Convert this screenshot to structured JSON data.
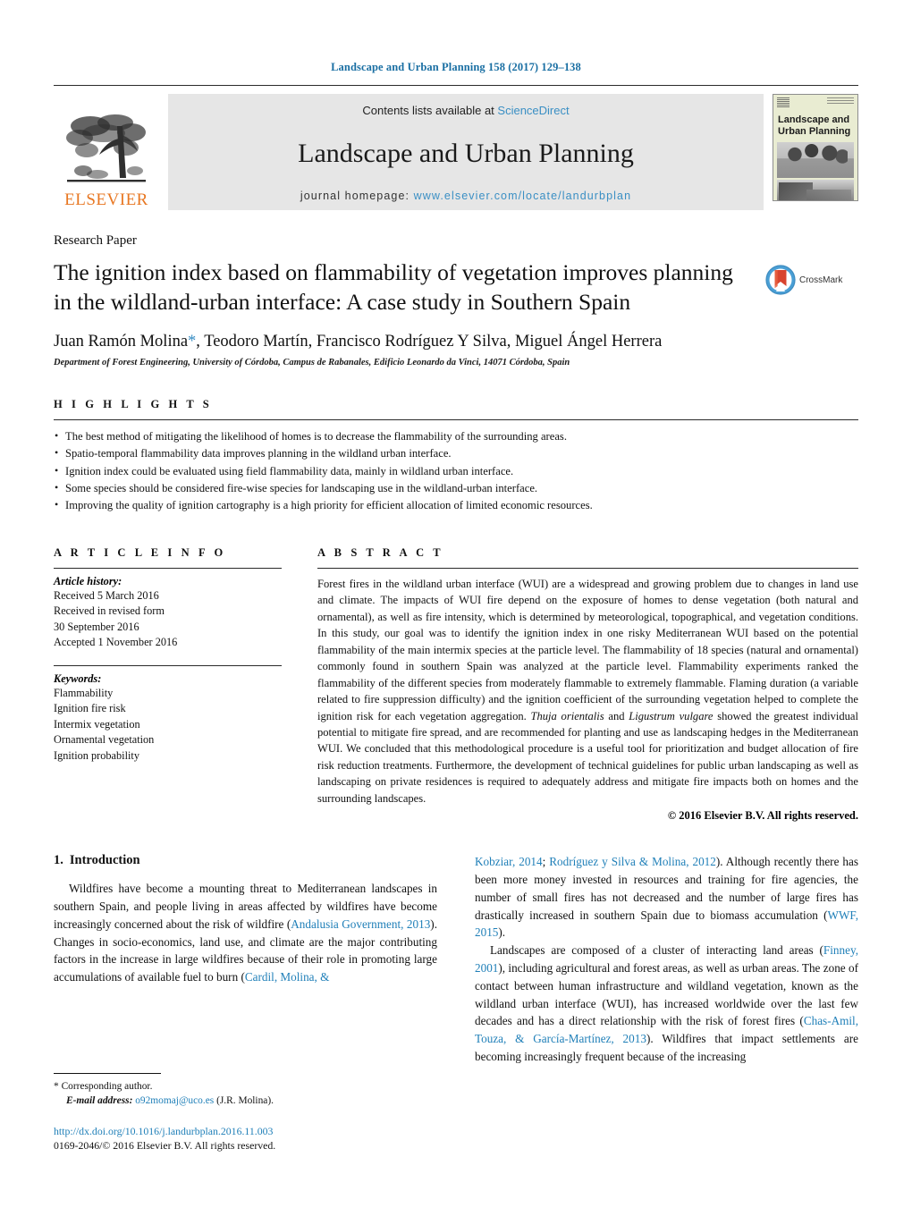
{
  "running_head": "Landscape and Urban Planning 158 (2017) 129–138",
  "masthead": {
    "publisher_name": "ELSEVIER",
    "contents_prefix": "Contents lists available at ",
    "contents_link": "ScienceDirect",
    "journal_title": "Landscape and Urban Planning",
    "homepage_prefix": "journal homepage: ",
    "homepage_url": "www.elsevier.com/locate/landurbplan",
    "cover_title_line1": "Landscape and",
    "cover_title_line2": "Urban Planning",
    "link_color": "#3a8fc4"
  },
  "article": {
    "type": "Research Paper",
    "title": "The ignition index based on flammability of vegetation improves planning in the wildland-urban interface: A case study in Southern Spain",
    "crossmark_label": "CrossMark",
    "authors": "Juan Ramón Molina",
    "authors_rest": ", Teodoro Martín, Francisco Rodríguez Y Silva, Miguel Ángel Herrera",
    "corresponding_marker": "*",
    "affiliation": "Department of Forest Engineering, University of Córdoba, Campus de Rabanales, Edificio Leonardo da Vinci, 14071 Córdoba, Spain"
  },
  "highlights": {
    "heading": "H I G H L I G H T S",
    "items": [
      "The best method of mitigating the likelihood of homes is to decrease the flammability of the surrounding areas.",
      "Spatio-temporal flammability data improves planning in the wildland urban interface.",
      "Ignition index could be evaluated using field flammability data, mainly in wildland urban interface.",
      "Some species should be considered fire-wise species for landscaping use in the wildland-urban interface.",
      "Improving the quality of ignition cartography is a high priority for efficient allocation of limited economic resources."
    ]
  },
  "article_info": {
    "heading": "A R T I C L E   I N F O",
    "history_label": "Article history:",
    "history": [
      "Received 5 March 2016",
      "Received in revised form",
      "30 September 2016",
      "Accepted 1 November 2016"
    ],
    "keywords_label": "Keywords:",
    "keywords": [
      "Flammability",
      "Ignition fire risk",
      "Intermix vegetation",
      "Ornamental vegetation",
      "Ignition probability"
    ]
  },
  "abstract": {
    "heading": "A B S T R A C T",
    "part1": "Forest fires in the wildland urban interface (WUI) are a widespread and growing problem due to changes in land use and climate. The impacts of WUI fire depend on the exposure of homes to dense vegetation (both natural and ornamental), as well as fire intensity, which is determined by meteorological, topographical, and vegetation conditions. In this study, our goal was to identify the ignition index in one risky Mediterranean WUI based on the potential flammability of the main intermix species at the particle level. The flammability of 18 species (natural and ornamental) commonly found in southern Spain was analyzed at the particle level. Flammability experiments ranked the flammability of the different species from moderately flammable to extremely flammable. Flaming duration (a variable related to fire suppression difficulty) and the ignition coefficient of the surrounding vegetation helped to complete the ignition risk for each vegetation aggregation. ",
    "italic1": "Thuja orientalis",
    "mid1": " and ",
    "italic2": "Ligustrum vulgare",
    "part2": " showed the greatest individual potential to mitigate fire spread, and are recommended for planting and use as landscaping hedges in the Mediterranean WUI. We concluded that this methodological procedure is a useful tool for prioritization and budget allocation of fire risk reduction treatments. Furthermore, the development of technical guidelines for public urban landscaping as well as landscaping on private residences is required to adequately address and mitigate fire impacts both on homes and the surrounding landscapes.",
    "copyright": "© 2016 Elsevier B.V. All rights reserved."
  },
  "introduction": {
    "number": "1.",
    "title": "Introduction",
    "left_p1_a": "Wildfires have become a mounting threat to Mediterranean landscapes in southern Spain, and people living in areas affected by wildfires have become increasingly concerned about the risk of wildfire (",
    "left_ref1": "Andalusia Government, 2013",
    "left_p1_b": "). Changes in socio-economics, land use, and climate are the major contributing factors in the increase in large wildfires because of their role in promoting large accumulations of available fuel to burn (",
    "left_ref2": "Cardil, Molina, &",
    "right_ref2_cont": "Kobziar, 2014",
    "right_semicolon": "; ",
    "right_ref3": "Rodríguez y Silva & Molina, 2012",
    "right_p1_b": "). Although recently there has been more money invested in resources and training for fire agencies, the number of small fires has not decreased and the number of large fires has drastically increased in southern Spain due to biomass accumulation (",
    "right_ref4": "WWF, 2015",
    "right_p1_c": ").",
    "right_p2_a": "Landscapes are composed of a cluster of interacting land areas (",
    "right_ref5": "Finney, 2001",
    "right_p2_b": "), including agricultural and forest areas, as well as urban areas. The zone of contact between human infrastructure and wildland vegetation, known as the wildland urban interface (WUI), has increased worldwide over the last few decades and has a direct relationship with the risk of forest fires (",
    "right_ref6": "Chas-Amil, Touza, & García-Martínez, 2013",
    "right_p2_c": "). Wildfires that impact settlements are becoming increasingly frequent because of the increasing"
  },
  "footer": {
    "corresponding_marker": "*",
    "corresponding_text": "Corresponding author.",
    "email_label": "E-mail address:",
    "email": "o92momaj@uco.es",
    "email_suffix": "(J.R. Molina).",
    "doi": "http://dx.doi.org/10.1016/j.landurbplan.2016.11.003",
    "issn": "0169-2046/© 2016 Elsevier B.V. All rights reserved."
  }
}
